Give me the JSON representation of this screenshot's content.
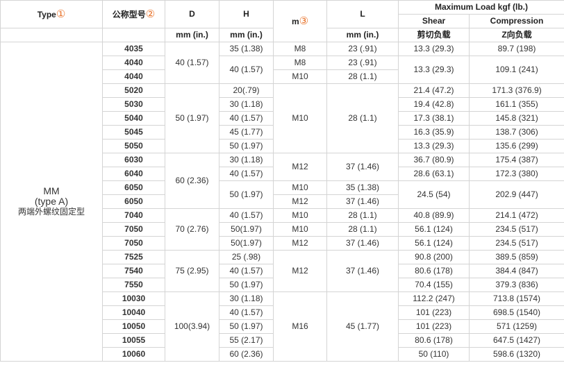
{
  "header": {
    "type_label": "Type",
    "type_circ": "①",
    "model_label": "公称型号",
    "model_circ": "②",
    "d_label": "D",
    "h_label": "H",
    "m_label": "m",
    "m_circ": "③",
    "l_label": "L",
    "max_load_label": "Maximum Load kgf (lb.)",
    "shear_label": "Shear",
    "compression_label": "Compression",
    "d_unit": "mm (in.)",
    "h_unit": "mm (in.)",
    "l_unit": "mm (in.)",
    "shear_cn": "剪切负载",
    "compression_cn": "Z向负载"
  },
  "type_cell": {
    "line1": "MM",
    "line2": "(type A)",
    "line3": "两端外螺纹固定型"
  },
  "rows": [
    {
      "model": "4035",
      "D": "40 (1.57)",
      "H": "35 (1.38)",
      "m": "M8",
      "L": "23 (.91)",
      "shear": "13.3 (29.3)",
      "comp": "89.7 (198)"
    },
    {
      "model": "4040",
      "D": "",
      "H": "40 (1.57)",
      "m": "M8",
      "L": "23 (.91)",
      "shear": "13.3 (29.3)",
      "comp": "109.1 (241)"
    },
    {
      "model": "4040",
      "D": "",
      "H": "",
      "m": "M10",
      "L": "28 (1.1)",
      "shear": "",
      "comp": ""
    },
    {
      "model": "5020",
      "D": "50 (1.97)",
      "H": "20(.79)",
      "m": "M10",
      "L": "28 (1.1)",
      "shear": "21.4 (47.2)",
      "comp": "171.3 (376.9)"
    },
    {
      "model": "5030",
      "D": "",
      "H": "30 (1.18)",
      "m": "",
      "L": "",
      "shear": "19.4 (42.8)",
      "comp": "161.1 (355)"
    },
    {
      "model": "5040",
      "D": "",
      "H": "40 (1.57)",
      "m": "",
      "L": "",
      "shear": "17.3 (38.1)",
      "comp": "145.8 (321)"
    },
    {
      "model": "5045",
      "D": "",
      "H": "45 (1.77)",
      "m": "",
      "L": "",
      "shear": "16.3 (35.9)",
      "comp": "138.7 (306)"
    },
    {
      "model": "5050",
      "D": "",
      "H": "50 (1.97)",
      "m": "",
      "L": "",
      "shear": "13.3 (29.3)",
      "comp": "135.6 (299)"
    },
    {
      "model": "6030",
      "D": "60 (2.36)",
      "H": "30 (1.18)",
      "m": "M12",
      "L": "37 (1.46)",
      "shear": "36.7 (80.9)",
      "comp": "175.4 (387)"
    },
    {
      "model": "6040",
      "D": "",
      "H": "40 (1.57)",
      "m": "",
      "L": "",
      "shear": "28.6 (63.1)",
      "comp": "172.3 (380)"
    },
    {
      "model": "6050",
      "D": "",
      "H": "50 (1.97)",
      "m": "M10",
      "L": "35 (1.38)",
      "shear": "24.5 (54)",
      "comp": "202.9 (447)"
    },
    {
      "model": "6050",
      "D": "",
      "H": "",
      "m": "M12",
      "L": "37 (1.46)",
      "shear": "",
      "comp": ""
    },
    {
      "model": "7040",
      "D": "70 (2.76)",
      "H": "40 (1.57)",
      "m": "M10",
      "L": "28 (1.1)",
      "shear": "40.8 (89.9)",
      "comp": "214.1 (472)"
    },
    {
      "model": "7050",
      "D": "",
      "H": "50(1.97)",
      "m": "M10",
      "L": "28 (1.1)",
      "shear": "56.1 (124)",
      "comp": "234.5 (517)"
    },
    {
      "model": "7050",
      "D": "",
      "H": "50(1.97)",
      "m": "M12",
      "L": "37 (1.46)",
      "shear": "56.1 (124)",
      "comp": "234.5 (517)"
    },
    {
      "model": "7525",
      "D": "75 (2.95)",
      "H": "25 (.98)",
      "m": "M12",
      "L": "37 (1.46)",
      "shear": "90.8 (200)",
      "comp": "389.5 (859)"
    },
    {
      "model": "7540",
      "D": "",
      "H": "40 (1.57)",
      "m": "",
      "L": "",
      "shear": "80.6 (178)",
      "comp": "384.4 (847)"
    },
    {
      "model": "7550",
      "D": "",
      "H": "50 (1.97)",
      "m": "",
      "L": "",
      "shear": "70.4 (155)",
      "comp": "379.3 (836)"
    },
    {
      "model": "10030",
      "D": "100(3.94)",
      "H": "30 (1.18)",
      "m": "M16",
      "L": "45 (1.77)",
      "shear": "112.2 (247)",
      "comp": "713.8 (1574)"
    },
    {
      "model": "10040",
      "D": "",
      "H": "40 (1.57)",
      "m": "",
      "L": "",
      "shear": "101 (223)",
      "comp": "698.5 (1540)"
    },
    {
      "model": "10050",
      "D": "",
      "H": "50 (1.97)",
      "m": "",
      "L": "",
      "shear": "101 (223)",
      "comp": "571 (1259)"
    },
    {
      "model": "10055",
      "D": "",
      "H": "55 (2.17)",
      "m": "",
      "L": "",
      "shear": "80.6 (178)",
      "comp": "647.5 (1427)"
    },
    {
      "model": "10060",
      "D": "",
      "H": "60 (2.36)",
      "m": "",
      "L": "",
      "shear": "50 (110)",
      "comp": "598.6 (1320)"
    }
  ]
}
